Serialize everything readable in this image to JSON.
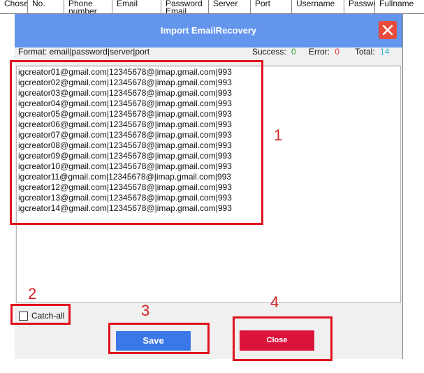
{
  "background_table": {
    "columns": [
      "Chose",
      "No.",
      "Phone number",
      "Email",
      "Password Email",
      "Server",
      "Port",
      "Username",
      "Passwo",
      "Fullname"
    ]
  },
  "dialog": {
    "title": "Import EmailRecovery",
    "format_label": "Format: email|password|server|port",
    "stats": {
      "success_label": "Success:",
      "success_value": "0",
      "error_label": "Error:",
      "error_value": "0",
      "total_label": "Total:",
      "total_value": "14"
    },
    "lines": [
      "igcreator01@gmail.com|12345678@|imap.gmail.com|993",
      "igcreator02@gmail.com|12345678@|imap.gmail.com|993",
      "igcreator03@gmail.com|12345678@|imap.gmail.com|993",
      "igcreator04@gmail.com|12345678@|imap.gmail.com|993",
      "igcreator05@gmail.com|12345678@|imap.gmail.com|993",
      "igcreator06@gmail.com|12345678@|imap.gmail.com|993",
      "igcreator07@gmail.com|12345678@|imap.gmail.com|993",
      "igcreator08@gmail.com|12345678@|imap.gmail.com|993",
      "igcreator09@gmail.com|12345678@|imap.gmail.com|993",
      "igcreator10@gmail.com|12345678@|imap.gmail.com|993",
      "igcreator11@gmail.com|12345678@|imap.gmail.com|993",
      "igcreator12@gmail.com|12345678@|imap.gmail.com|993",
      "igcreator13@gmail.com|12345678@|imap.gmail.com|993",
      "igcreator14@gmail.com|12345678@|imap.gmail.com|993"
    ],
    "catch_all_label": "Catch-all",
    "catch_all_checked": false,
    "save_label": "Save",
    "close_label": "Close",
    "close_icon": "close-x-icon"
  },
  "annotations": [
    "1",
    "2",
    "3",
    "4"
  ],
  "colors": {
    "titlebar": "#6495ed",
    "close_x": "#e84b3c",
    "save": "#3b78e7",
    "close_button": "#dc143c",
    "annotation": "#e0121d"
  }
}
